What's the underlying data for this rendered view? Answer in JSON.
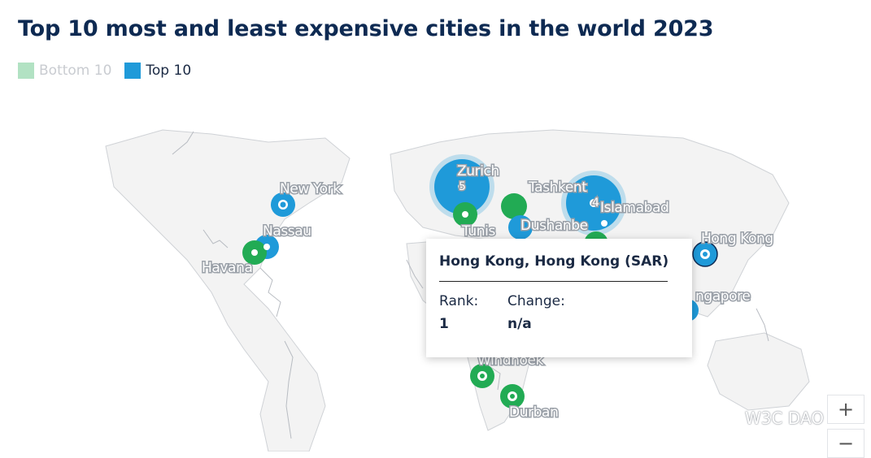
{
  "title": "Top 10 most and least expensive cities in the world 2023",
  "legend": {
    "bottom10_label": "Bottom 10",
    "top10_label": "Top 10"
  },
  "colors": {
    "top10": "#1f9ad9",
    "bottom10": "#22ab54",
    "land": "#f3f3f3",
    "title": "#0e2a52"
  },
  "map": {
    "cities": [
      {
        "name": "Zurich",
        "group": "top10",
        "cluster_count": "5"
      },
      {
        "name": "Tashkent",
        "group": "bottom10",
        "cluster_count": ""
      },
      {
        "name": "Islamabad",
        "group": "bottom10",
        "cluster_count": "4"
      },
      {
        "name": "New York",
        "group": "top10",
        "cluster_count": ""
      },
      {
        "name": "Nassau",
        "group": "top10",
        "cluster_count": ""
      },
      {
        "name": "Havana",
        "group": "bottom10",
        "cluster_count": ""
      },
      {
        "name": "Tunis",
        "group": "bottom10",
        "cluster_count": ""
      },
      {
        "name": "Dushanbe",
        "group": "bottom10",
        "cluster_count": ""
      },
      {
        "name": "Hong Kong",
        "group": "top10",
        "cluster_count": ""
      },
      {
        "name": "Singapore",
        "group": "top10",
        "cluster_count": ""
      },
      {
        "name": "Windhoek",
        "group": "bottom10",
        "cluster_count": ""
      },
      {
        "name": "Durban",
        "group": "bottom10",
        "cluster_count": ""
      }
    ]
  },
  "labels": {
    "zurich": "Zurich",
    "zurich_count": "5",
    "tashkent": "Tashkent",
    "islamabad": "Islamabad",
    "islamabad_count": "4",
    "new_york": "New York",
    "nassau": "Nassau",
    "havana": "Havana",
    "tunis": "Tunis",
    "dushanbe": "Dushanbe",
    "hong_kong": "Hong Kong",
    "singapore": "ngapore",
    "windhoek": "Windhoek",
    "durban": "Durban"
  },
  "tooltip": {
    "title": "Hong Kong, Hong Kong (SAR)",
    "rank_label": "Rank:",
    "change_label": "Change:",
    "rank_value": "1",
    "change_value": "n/a"
  },
  "zoom": {
    "in_label": "+",
    "out_label": "−"
  },
  "watermark": "W3C DAO"
}
